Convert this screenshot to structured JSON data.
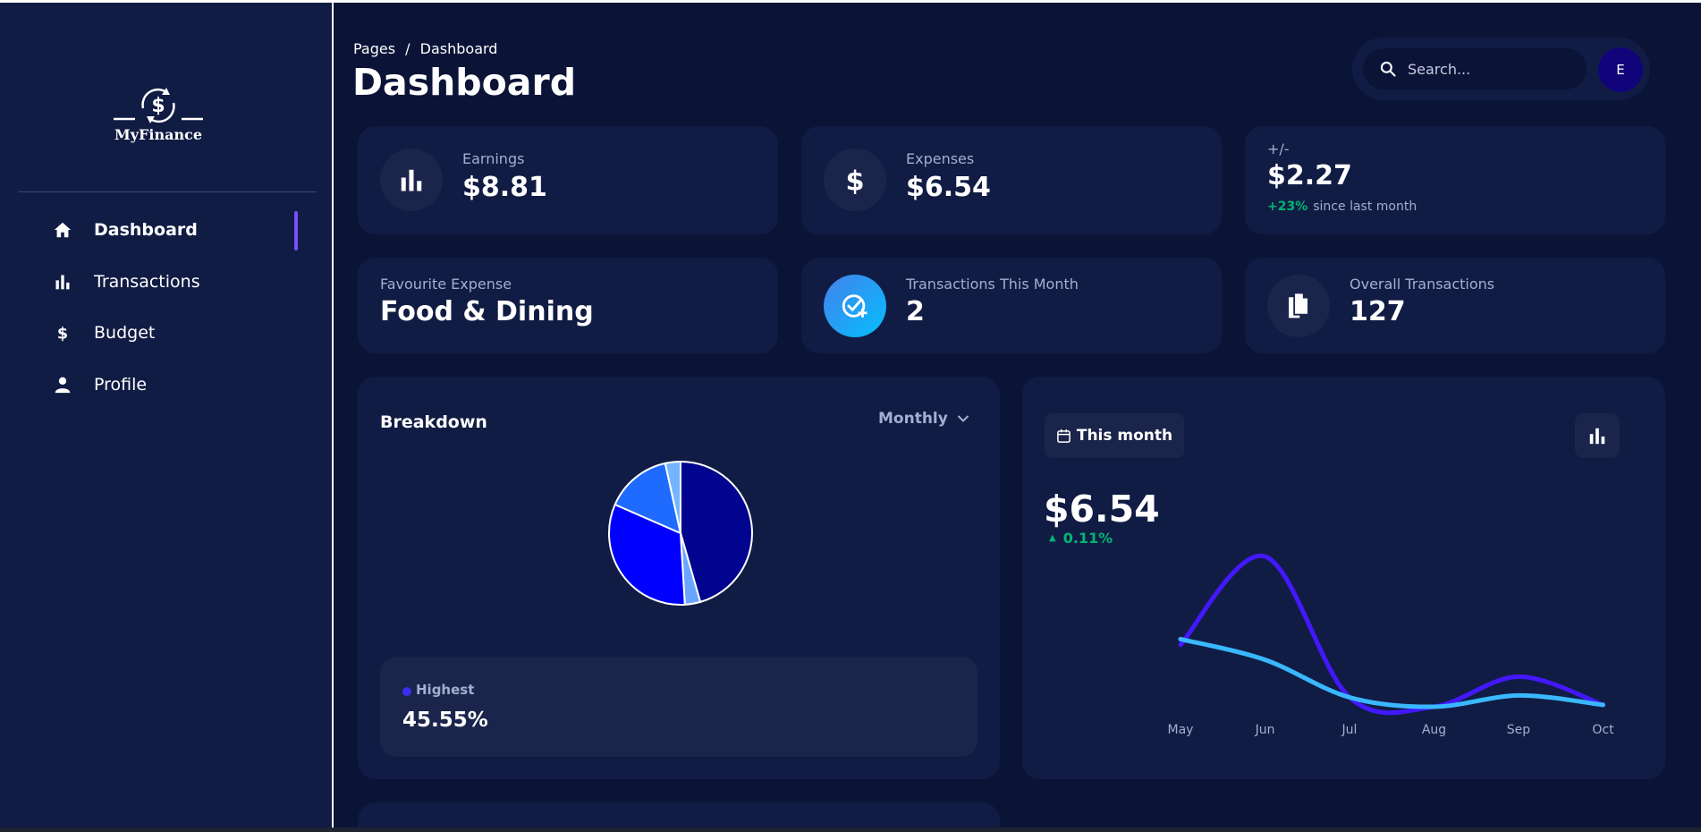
{
  "app": {
    "logo_text": "MyFinance",
    "accent_color": "#7551ff",
    "positive_color": "#01b574"
  },
  "sidebar": {
    "items": [
      {
        "label": "Dashboard",
        "icon": "home-icon",
        "active": true
      },
      {
        "label": "Transactions",
        "icon": "bar-chart-icon",
        "active": false
      },
      {
        "label": "Budget",
        "icon": "dollar-icon",
        "active": false
      },
      {
        "label": "Profile",
        "icon": "person-icon",
        "active": false
      }
    ]
  },
  "header": {
    "breadcrumb": [
      "Pages",
      "/",
      "Dashboard"
    ],
    "title": "Dashboard",
    "search_placeholder": "Search...",
    "avatar_initial": "E"
  },
  "stats": {
    "earnings": {
      "label": "Earnings",
      "value": "$8.81",
      "icon": "bar-chart-icon"
    },
    "expenses": {
      "label": "Expenses",
      "value": "$6.54",
      "icon": "dollar-icon"
    },
    "net": {
      "label": "+/-",
      "value": "$2.27",
      "change": "+23%",
      "change_text": "since last month"
    },
    "favourite": {
      "label": "Favourite Expense",
      "value": "Food & Dining"
    },
    "transactions_month": {
      "label": "Transactions This Month",
      "value": "2",
      "icon": "check-add-icon"
    },
    "overall": {
      "label": "Overall Transactions",
      "value": "127",
      "icon": "documents-icon"
    }
  },
  "breakdown": {
    "title": "Breakdown",
    "period": "Monthly",
    "legend_label": "Highest",
    "legend_value": "45.55%"
  },
  "spending": {
    "period_button": "This month",
    "amount": "$6.54",
    "trend": "0.11%"
  },
  "chart_data": [
    {
      "type": "pie",
      "title": "Breakdown",
      "slices": [
        {
          "value": 45.55,
          "color": "#00048f"
        },
        {
          "value": 3.5,
          "color": "#6aa6ff"
        },
        {
          "value": 32.5,
          "color": "#0000ff"
        },
        {
          "value": 15.0,
          "color": "#1f6bff"
        },
        {
          "value": 3.45,
          "color": "#74b5ff"
        }
      ]
    },
    {
      "type": "line",
      "categories": [
        "May",
        "Jun",
        "Jul",
        "Aug",
        "Sep",
        "Oct"
      ],
      "ylim": [
        0,
        10
      ],
      "grid": false,
      "series": [
        {
          "color": "#4318ff",
          "values": [
            3.3,
            8.0,
            0.5,
            0.0,
            1.6,
            0.1
          ]
        },
        {
          "color": "#39b8ff",
          "values": [
            3.6,
            2.5,
            0.5,
            0.0,
            0.6,
            0.1
          ]
        }
      ]
    }
  ]
}
